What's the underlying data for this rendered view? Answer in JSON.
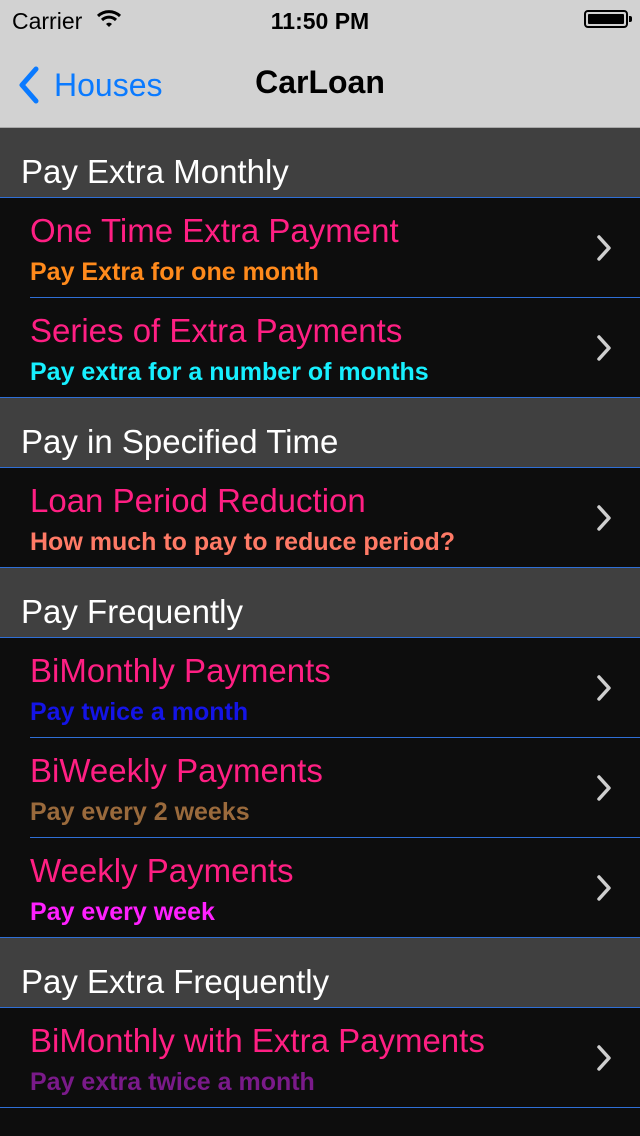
{
  "status_bar": {
    "carrier": "Carrier",
    "time": "11:50 PM"
  },
  "nav": {
    "back_label": "Houses",
    "title": "CarLoan"
  },
  "sections": [
    {
      "header": "Pay Extra Monthly",
      "rows": [
        {
          "title": "One Time Extra Payment",
          "subtitle": "Pay Extra for one month",
          "subtitle_color": "#ff8a1c"
        },
        {
          "title": "Series of Extra Payments",
          "subtitle": "Pay extra for a number of months",
          "subtitle_color": "#17f0ff"
        }
      ]
    },
    {
      "header": "Pay in Specified Time",
      "rows": [
        {
          "title": "Loan Period Reduction",
          "subtitle": "How much to pay to reduce period?",
          "subtitle_color": "#ff7a66"
        }
      ]
    },
    {
      "header": "Pay Frequently",
      "rows": [
        {
          "title": "BiMonthly Payments",
          "subtitle": "Pay twice a month",
          "subtitle_color": "#1414e6"
        },
        {
          "title": "BiWeekly Payments",
          "subtitle": "Pay every 2 weeks",
          "subtitle_color": "#9a6a3c"
        },
        {
          "title": "Weekly Payments",
          "subtitle": "Pay every week",
          "subtitle_color": "#ff20ff"
        }
      ]
    },
    {
      "header": "Pay Extra Frequently",
      "rows": [
        {
          "title": "BiMonthly with Extra Payments",
          "subtitle": "Pay extra twice a month",
          "subtitle_color": "#7a1a8a"
        }
      ]
    }
  ],
  "colors": {
    "title_pink": "#ff1f83",
    "accent_blue": "#0a7aff",
    "separator_blue": "#2f6fd6"
  },
  "icons": {
    "back": "chevron-left-icon",
    "disclosure": "chevron-right-icon",
    "wifi": "wifi-icon",
    "battery": "battery-icon"
  }
}
